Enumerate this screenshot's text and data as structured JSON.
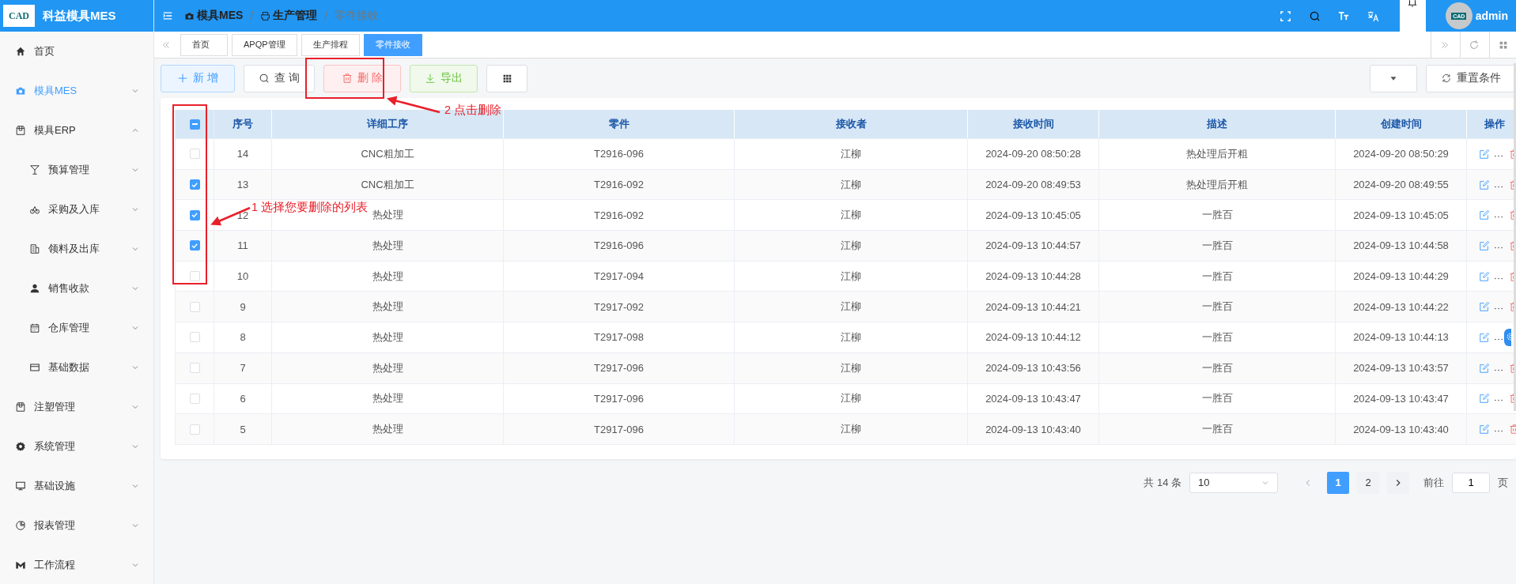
{
  "app": {
    "logo_text": "CAD",
    "title": "科益模具MES"
  },
  "sidebar": {
    "items": [
      {
        "kind": "link",
        "label": "首页",
        "selected": false
      },
      {
        "kind": "group",
        "label": "模具MES",
        "selected": true,
        "expanded": false
      },
      {
        "kind": "group",
        "label": "模具ERP",
        "selected": false,
        "expanded": true,
        "children": [
          {
            "kind": "group",
            "label": "预算管理",
            "selected": false,
            "expanded": false
          },
          {
            "kind": "group",
            "label": "采购及入库",
            "selected": false,
            "expanded": false
          },
          {
            "kind": "group",
            "label": "领料及出库",
            "selected": false,
            "expanded": false
          },
          {
            "kind": "group",
            "label": "销售收款",
            "selected": false,
            "expanded": false
          },
          {
            "kind": "group",
            "label": "仓库管理",
            "selected": false,
            "expanded": false
          },
          {
            "kind": "group",
            "label": "基础数据",
            "selected": false,
            "expanded": false
          }
        ]
      },
      {
        "kind": "group",
        "label": "注塑管理",
        "selected": false,
        "expanded": false
      },
      {
        "kind": "group",
        "label": "系统管理",
        "selected": false,
        "expanded": false
      },
      {
        "kind": "group",
        "label": "基础设施",
        "selected": false,
        "expanded": false
      },
      {
        "kind": "group",
        "label": "报表管理",
        "selected": false,
        "expanded": false
      },
      {
        "kind": "group",
        "label": "工作流程",
        "selected": false,
        "expanded": false
      }
    ]
  },
  "breadcrumb": [
    {
      "kind": "link",
      "label": "模具MES",
      "current": false
    },
    {
      "kind": "separator",
      "label": "/"
    },
    {
      "kind": "link",
      "label": "生产管理",
      "current": false
    },
    {
      "kind": "separator",
      "label": "/"
    },
    {
      "kind": "link",
      "label": "零件接收",
      "current": true
    }
  ],
  "user": {
    "avatar_text": "CAD",
    "name": "admin"
  },
  "tabs": [
    {
      "label": "首页",
      "selected": false
    },
    {
      "label": "APQP管理",
      "selected": false
    },
    {
      "label": "生产排程",
      "selected": false
    },
    {
      "label": "零件接收",
      "selected": true
    }
  ],
  "toolbar": {
    "buttons": [
      {
        "kind": "add",
        "label": "新 增"
      },
      {
        "kind": "search",
        "label": "查 询"
      },
      {
        "kind": "delete",
        "label": "删 除"
      },
      {
        "kind": "export",
        "label": "导出"
      }
    ],
    "reset_label": "重置条件"
  },
  "table": {
    "select_all_indeterminate": true,
    "columns": [
      "序号",
      "详细工序",
      "零件",
      "接收者",
      "接收时间",
      "描述",
      "创建时间",
      "操作"
    ],
    "rows": [
      {
        "checked": false,
        "settings_badge": false,
        "cells": [
          "14",
          "CNC粗加工",
          "T2916-096",
          "江柳",
          "2024-09-20 08:50:28",
          "热处理后开粗",
          "2024-09-20 08:50:29"
        ]
      },
      {
        "checked": true,
        "settings_badge": false,
        "cells": [
          "13",
          "CNC粗加工",
          "T2916-092",
          "江柳",
          "2024-09-20 08:49:53",
          "热处理后开粗",
          "2024-09-20 08:49:55"
        ]
      },
      {
        "checked": true,
        "settings_badge": false,
        "cells": [
          "12",
          "热处理",
          "T2916-092",
          "江柳",
          "2024-09-13 10:45:05",
          "一胜百",
          "2024-09-13 10:45:05"
        ]
      },
      {
        "checked": true,
        "settings_badge": false,
        "cells": [
          "11",
          "热处理",
          "T2916-096",
          "江柳",
          "2024-09-13 10:44:57",
          "一胜百",
          "2024-09-13 10:44:58"
        ]
      },
      {
        "checked": false,
        "settings_badge": false,
        "cells": [
          "10",
          "热处理",
          "T2917-094",
          "江柳",
          "2024-09-13 10:44:28",
          "一胜百",
          "2024-09-13 10:44:29"
        ]
      },
      {
        "checked": false,
        "settings_badge": false,
        "cells": [
          "9",
          "热处理",
          "T2917-092",
          "江柳",
          "2024-09-13 10:44:21",
          "一胜百",
          "2024-09-13 10:44:22"
        ]
      },
      {
        "checked": false,
        "settings_badge": true,
        "cells": [
          "8",
          "热处理",
          "T2917-098",
          "江柳",
          "2024-09-13 10:44:12",
          "一胜百",
          "2024-09-13 10:44:13"
        ]
      },
      {
        "checked": false,
        "settings_badge": false,
        "cells": [
          "7",
          "热处理",
          "T2917-096",
          "江柳",
          "2024-09-13 10:43:56",
          "一胜百",
          "2024-09-13 10:43:57"
        ]
      },
      {
        "checked": false,
        "settings_badge": false,
        "cells": [
          "6",
          "热处理",
          "T2917-096",
          "江柳",
          "2024-09-13 10:43:47",
          "一胜百",
          "2024-09-13 10:43:47"
        ]
      },
      {
        "checked": false,
        "settings_badge": false,
        "cells": [
          "5",
          "热处理",
          "T2917-096",
          "江柳",
          "2024-09-13 10:43:40",
          "一胜百",
          "2024-09-13 10:43:40"
        ]
      }
    ]
  },
  "pagination": {
    "total": "共 14 条",
    "page_size": "10",
    "pages": [
      {
        "label": "1",
        "selected": true
      },
      {
        "label": "2",
        "selected": false
      }
    ],
    "prev_disabled": true,
    "goto_label": "前往",
    "goto_value": "1",
    "page_suffix": "页"
  },
  "annotations": [
    {
      "kind": "select",
      "text": "1 选择您要删除的列表"
    },
    {
      "kind": "delete",
      "text": "2 点击删除"
    }
  ]
}
